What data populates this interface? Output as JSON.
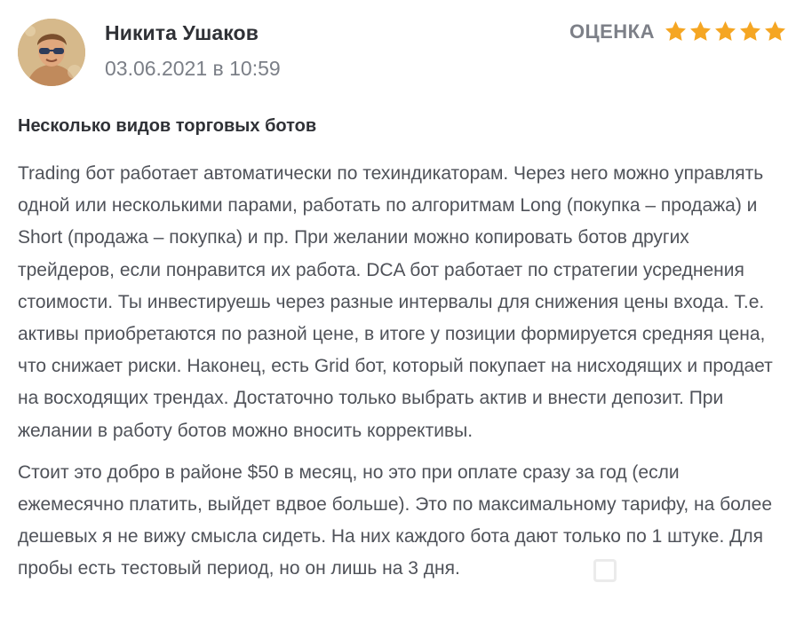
{
  "review": {
    "author": "Никита Ушаков",
    "date": "03.06.2021 в 10:59",
    "rating_label": "ОЦЕНКА",
    "rating": 5,
    "rating_max": 5,
    "title": "Несколько видов торговых ботов",
    "paragraphs": [
      "Trading бот работает автоматически по техиндикаторам. Через него можно управлять одной или несколькими парами, работать по алгоритмам Long (покупка – продажа) и Short (продажа – покупка) и пр. При желании можно копировать ботов других трейдеров, если понравится их работа. DCA бот работает по стратегии усреднения стоимости. Ты инвестируешь через разные интервалы для снижения цены входа. Т.е. активы приобретаются по разной цене, в итоге у позиции формируется средняя цена, что снижает риски. Наконец, есть Grid бот, который покупает на нисходящих и продает на восходящих трендах. Достаточно только выбрать актив и внести депозит. При желании в работу ботов можно вносить коррективы.",
      "Стоит это добро в районе $50 в месяц, но это при оплате сразу за год (если ежемесячно платить, выйдет вдвое больше). Это по максимальному тарифу, на более дешевых я не вижу смысла сидеть. На них каждого бота дают только по 1 штуке. Для пробы есть тестовый период, но он лишь на 3 дня."
    ]
  },
  "colors": {
    "star": "#f5a623",
    "author": "#2f3136",
    "date": "#7b7f87",
    "text": "#4f5259"
  },
  "icons": {
    "avatar": "user-photo",
    "star": "star-icon"
  }
}
